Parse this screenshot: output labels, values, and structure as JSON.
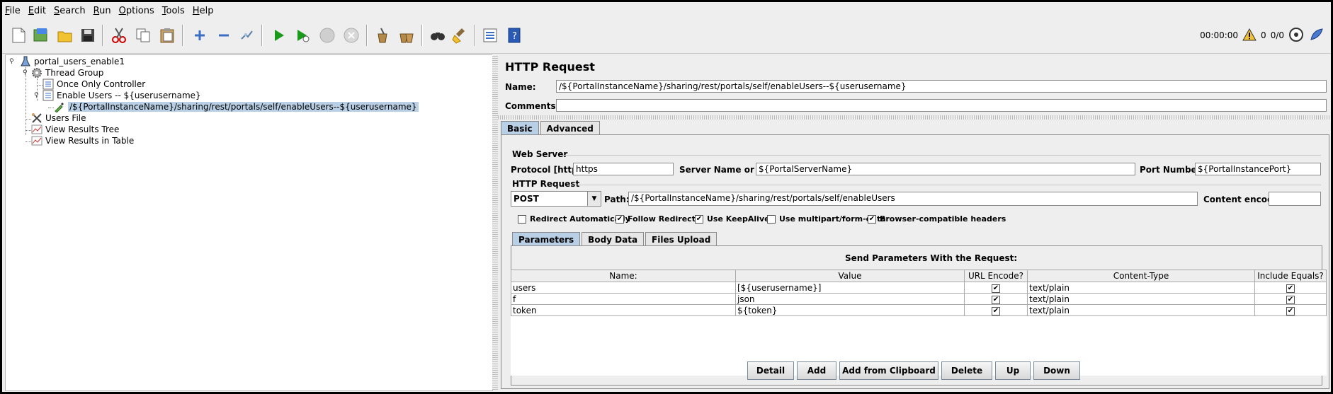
{
  "menu": [
    "File",
    "Edit",
    "Search",
    "Run",
    "Options",
    "Tools",
    "Help"
  ],
  "toolbar": {
    "buttons": [
      "new-icon",
      "templates-icon",
      "open-icon",
      "save-icon",
      "cut-icon",
      "copy-icon",
      "paste-icon",
      "expand-icon",
      "collapse-icon",
      "toggle-icon",
      "start-icon",
      "start-no-pause-icon",
      "stop-icon",
      "shutdown-icon",
      "clear-icon",
      "clear-all-icon",
      "search-icon",
      "reset-search-icon",
      "function-helper-icon",
      "help-icon"
    ]
  },
  "status": {
    "timer": "00:00:00",
    "warnings": "0",
    "threads": "0/0"
  },
  "tree": {
    "root": "portal_users_enable1",
    "thread_group": "Thread Group",
    "once_only": "Once Only Controller",
    "enable_users": "Enable Users -- ${userusername}",
    "sampler": "/${PortalInstanceName}/sharing/rest/portals/self/enableUsers--${userusername}",
    "users_file": "Users File",
    "results_tree": "View Results Tree",
    "results_table": "View Results in Table"
  },
  "panel": {
    "title": "HTTP Request",
    "name_label": "Name:",
    "name_value": "/${PortalInstanceName}/sharing/rest/portals/self/enableUsers--${userusername}",
    "comments_label": "Comments:",
    "comments_value": "",
    "tabs": [
      "Basic",
      "Advanced"
    ],
    "web_server": "Web Server",
    "protocol_label": "Protocol [http]:",
    "protocol_value": "https",
    "server_label": "Server Name or IP:",
    "server_value": "${PortalServerName}",
    "port_label": "Port Number:",
    "port_value": "${PortalInstancePort}",
    "http_request_group": "HTTP Request",
    "method": "POST",
    "path_label": "Path:",
    "path_value": "/${PortalInstanceName}/sharing/rest/portals/self/enableUsers",
    "encoding_label": "Content encoding:",
    "encoding_value": "",
    "checkboxes": [
      {
        "label": "Redirect Automatically",
        "checked": false
      },
      {
        "label": "Follow Redirects",
        "checked": true
      },
      {
        "label": "Use KeepAlive",
        "checked": true
      },
      {
        "label": "Use multipart/form-data",
        "checked": false
      },
      {
        "label": "Browser-compatible headers",
        "checked": true
      }
    ],
    "subtabs": [
      "Parameters",
      "Body Data",
      "Files Upload"
    ],
    "params_title": "Send Parameters With the Request:",
    "columns": [
      "Name:",
      "Value",
      "URL Encode?",
      "Content-Type",
      "Include Equals?"
    ],
    "rows": [
      {
        "name": "users",
        "value": "[${userusername}]",
        "encode": true,
        "type": "text/plain",
        "equals": true
      },
      {
        "name": "f",
        "value": "json",
        "encode": true,
        "type": "text/plain",
        "equals": true
      },
      {
        "name": "token",
        "value": "${token}",
        "encode": true,
        "type": "text/plain",
        "equals": true
      }
    ],
    "buttons": [
      "Detail",
      "Add",
      "Add from Clipboard",
      "Delete",
      "Up",
      "Down"
    ]
  }
}
